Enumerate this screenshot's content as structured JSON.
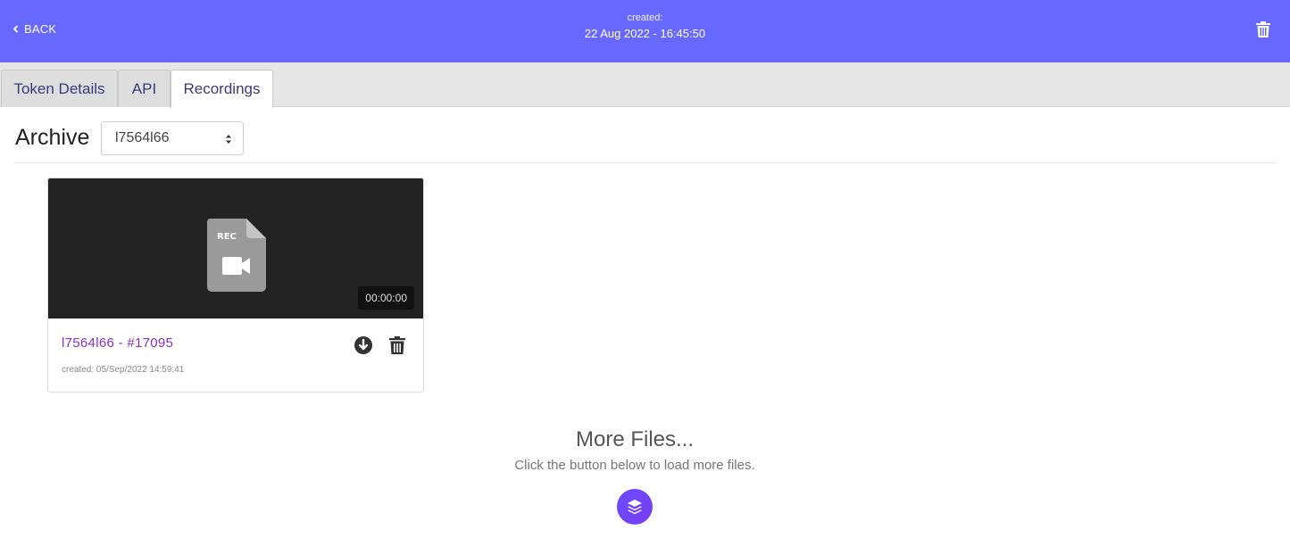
{
  "header": {
    "back_label": "BACK",
    "created_label": "created:",
    "created_date": "22 Aug 2022 - 16:45:50",
    "background_color": "#6768ff"
  },
  "tabs": [
    {
      "label": "Token Details",
      "active": false
    },
    {
      "label": "API",
      "active": false
    },
    {
      "label": "Recordings",
      "active": true
    }
  ],
  "archive": {
    "title": "Archive",
    "selected": "l7564l66"
  },
  "recordings": [
    {
      "title": "l7564l66 - #17095",
      "created": "created: 05/Sep/2022 14:59:41",
      "duration": "00:00:00",
      "thumb_label": "REC"
    }
  ],
  "more": {
    "title": "More Files...",
    "subtitle": "Click the button below to load more files."
  },
  "icons": {
    "back": "chevron-left-icon",
    "delete": "trash-icon",
    "download": "download-circle-icon",
    "load_more": "layers-icon",
    "file": "video-file-icon"
  },
  "colors": {
    "accent": "#6768ff",
    "link": "#8a2fc4",
    "load_button": "#6a4bff"
  }
}
